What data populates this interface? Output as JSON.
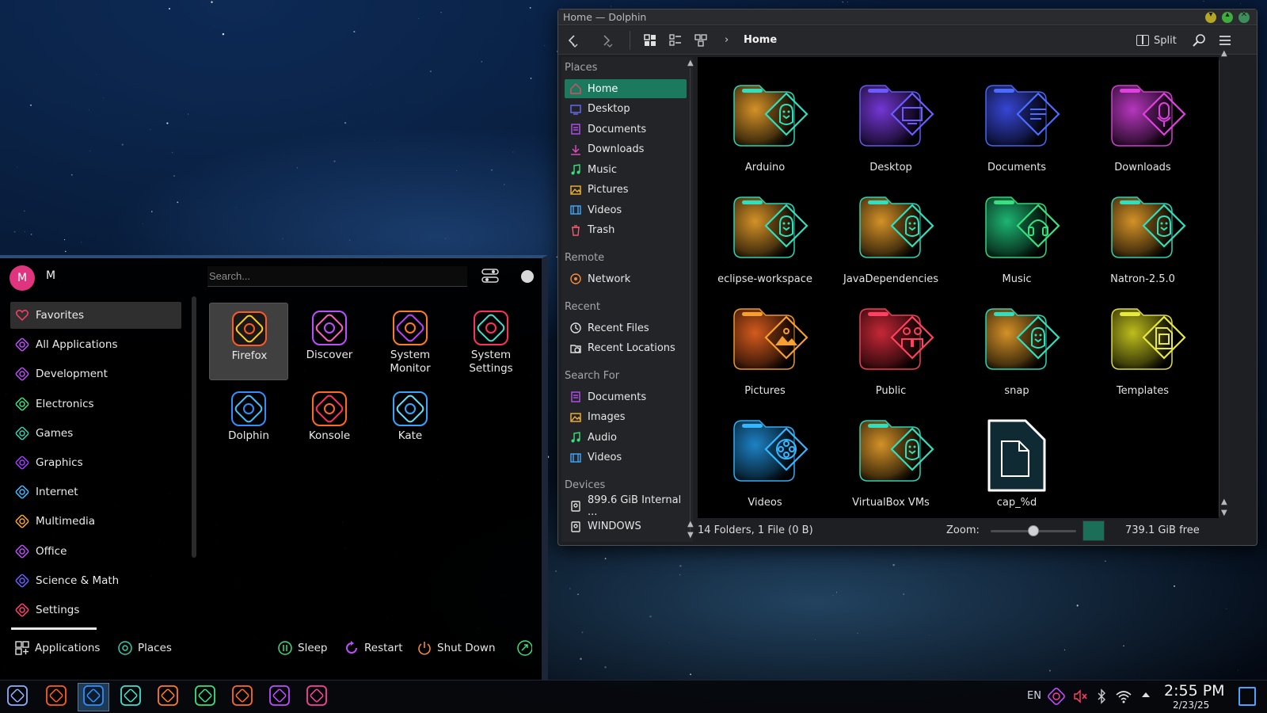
{
  "dolphin": {
    "title": "Home — Dolphin",
    "breadcrumb": "Home",
    "split_label": "Split",
    "places_sections": {
      "places": "Places",
      "remote": "Remote",
      "recent": "Recent",
      "search_for": "Search For",
      "devices": "Devices"
    },
    "places": [
      {
        "label": "Home",
        "icon": "home-icon",
        "color": "#e34a6a"
      },
      {
        "label": "Desktop",
        "icon": "desktop-icon",
        "color": "#6a6cff"
      },
      {
        "label": "Documents",
        "icon": "documents-icon",
        "color": "#b64ff0"
      },
      {
        "label": "Downloads",
        "icon": "downloads-icon",
        "color": "#e24fc2"
      },
      {
        "label": "Music",
        "icon": "music-icon",
        "color": "#38e07f"
      },
      {
        "label": "Pictures",
        "icon": "pictures-icon",
        "color": "#f5b335"
      },
      {
        "label": "Videos",
        "icon": "videos-icon",
        "color": "#3fa9ff"
      },
      {
        "label": "Trash",
        "icon": "trash-icon",
        "color": "#f05a6d"
      }
    ],
    "remote": [
      {
        "label": "Network",
        "icon": "network-icon",
        "color": "#f58a3a"
      }
    ],
    "recent": [
      {
        "label": "Recent Files",
        "icon": "clock-icon",
        "color": "#e0e0e0"
      },
      {
        "label": "Recent Locations",
        "icon": "folder-clock-icon",
        "color": "#e0e0e0"
      }
    ],
    "search_for": [
      {
        "label": "Documents",
        "icon": "documents-icon",
        "color": "#b64ff0"
      },
      {
        "label": "Images",
        "icon": "pictures-icon",
        "color": "#f5b335"
      },
      {
        "label": "Audio",
        "icon": "music-icon",
        "color": "#38e07f"
      },
      {
        "label": "Videos",
        "icon": "videos-icon",
        "color": "#3fa9ff"
      }
    ],
    "devices": [
      {
        "label": "899.6 GiB Internal ...",
        "icon": "drive-icon",
        "color": "#e0e0e0"
      },
      {
        "label": "WINDOWS",
        "icon": "drive-icon",
        "color": "#e0e0e0"
      }
    ],
    "items": [
      {
        "label": "Arduino",
        "color": "#e09a2a",
        "emblem": "tux",
        "accent": "#2fe0c0"
      },
      {
        "label": "Desktop",
        "color": "#7a3ae0",
        "emblem": "monitor",
        "accent": "#6a5cff"
      },
      {
        "label": "Documents",
        "color": "#3a4ae0",
        "emblem": "doc",
        "accent": "#4a6cff"
      },
      {
        "label": "Downloads",
        "color": "#c03ac8",
        "emblem": "download",
        "accent": "#e040e0"
      },
      {
        "label": "eclipse-workspace",
        "color": "#e09a2a",
        "emblem": "tux",
        "accent": "#2fe0c0"
      },
      {
        "label": "JavaDependencies",
        "color": "#e09a2a",
        "emblem": "tux",
        "accent": "#2fe0c0"
      },
      {
        "label": "Music",
        "color": "#1fbf78",
        "emblem": "headphones",
        "accent": "#38e07f"
      },
      {
        "label": "Natron-2.5.0",
        "color": "#e09a2a",
        "emblem": "tux",
        "accent": "#2fe0c0"
      },
      {
        "label": "Pictures",
        "color": "#e0601f",
        "emblem": "image",
        "accent": "#f5a030"
      },
      {
        "label": "Public",
        "color": "#d02a3a",
        "emblem": "people",
        "accent": "#ff4060"
      },
      {
        "label": "snap",
        "color": "#e09a2a",
        "emblem": "tux",
        "accent": "#2fe0c0"
      },
      {
        "label": "Templates",
        "color": "#c8c81f",
        "emblem": "template",
        "accent": "#e8e840"
      },
      {
        "label": "Videos",
        "color": "#1f8ad0",
        "emblem": "film",
        "accent": "#35b6ff"
      },
      {
        "label": "VirtualBox VMs",
        "color": "#e09a2a",
        "emblem": "tux",
        "accent": "#2fe0c0"
      },
      {
        "label": "cap_%d",
        "color": "#ffffff",
        "emblem": "file",
        "accent": "#ffffff"
      }
    ],
    "status": "14 Folders, 1 File (0 B)",
    "zoom_label": "Zoom:",
    "zoom_level": 0.5,
    "free_space": "739.1 GiB free"
  },
  "launcher": {
    "avatar_letter": "M",
    "username": "M",
    "search_placeholder": "Search...",
    "categories": [
      {
        "label": "Favorites",
        "icon": "heart-icon",
        "color": "#ff3d6a"
      },
      {
        "label": "All Applications",
        "icon": "apps-icon",
        "color": "#c04cff"
      },
      {
        "label": "Development",
        "icon": "development-icon",
        "color": "#b64ff0"
      },
      {
        "label": "Electronics",
        "icon": "electronics-icon",
        "color": "#38e07f"
      },
      {
        "label": "Games",
        "icon": "games-icon",
        "color": "#2fd0b0"
      },
      {
        "label": "Graphics",
        "icon": "graphics-icon",
        "color": "#a03cff"
      },
      {
        "label": "Internet",
        "icon": "internet-icon",
        "color": "#3fb9ff"
      },
      {
        "label": "Multimedia",
        "icon": "multimedia-icon",
        "color": "#f5a030"
      },
      {
        "label": "Office",
        "icon": "office-icon",
        "color": "#b64ff0"
      },
      {
        "label": "Science & Math",
        "icon": "science-icon",
        "color": "#6a5cff"
      },
      {
        "label": "Settings",
        "icon": "settings-icon",
        "color": "#ff4070"
      }
    ],
    "apps": [
      {
        "label": "Firefox",
        "icon": "firefox-icon",
        "color": "#ff5a20",
        "accent": "#ffcc20"
      },
      {
        "label": "Discover",
        "icon": "discover-icon",
        "color": "#c04cff",
        "accent": "#ff60c0"
      },
      {
        "label": "System Monitor",
        "icon": "system-monitor-icon",
        "color": "#ff7a20",
        "accent": "#c040ff"
      },
      {
        "label": "System Settings",
        "icon": "system-settings-icon",
        "color": "#ff3060",
        "accent": "#40e0d0"
      },
      {
        "label": "Dolphin",
        "icon": "dolphin-icon",
        "color": "#2f8fff",
        "accent": "#40c0ff"
      },
      {
        "label": "Konsole",
        "icon": "konsole-icon",
        "color": "#ff6a20",
        "accent": "#ff3060"
      },
      {
        "label": "Kate",
        "icon": "kate-icon",
        "color": "#35a6ff",
        "accent": "#60e0ff"
      }
    ],
    "footer": {
      "applications": "Applications",
      "places": "Places",
      "sleep": "Sleep",
      "restart": "Restart",
      "shut_down": "Shut Down"
    }
  },
  "taskbar": {
    "apps": [
      {
        "icon": "app-launcher-icon",
        "color": "#8ab0ff"
      },
      {
        "icon": "firefox-icon",
        "color": "#ff5a20"
      },
      {
        "icon": "dolphin-icon",
        "color": "#2f8fff"
      },
      {
        "icon": "kate-icon",
        "color": "#40e0d0"
      },
      {
        "icon": "system-monitor-icon",
        "color": "#ff7a20"
      },
      {
        "icon": "konsole-icon",
        "color": "#38e07f"
      },
      {
        "icon": "system-settings-icon",
        "color": "#ff6a20"
      },
      {
        "icon": "discover-icon",
        "color": "#c04cff"
      },
      {
        "icon": "games-icon",
        "color": "#ff40a0"
      }
    ],
    "keyboard_layout": "EN",
    "time": "2:55 PM",
    "date": "2/23/25"
  }
}
